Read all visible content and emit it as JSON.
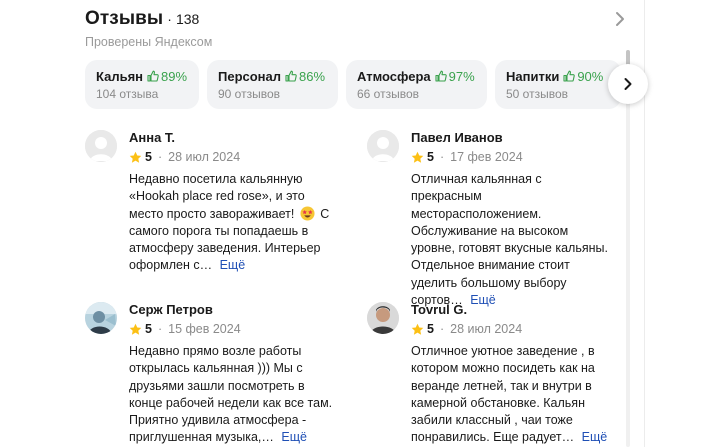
{
  "reviews_section": {
    "title": "Отзывы",
    "dot": "·",
    "count": "138",
    "subtitle": "Проверены Яндексом",
    "chips": [
      {
        "label": "Кальян",
        "percent": "89%",
        "sub": "104 отзыва"
      },
      {
        "label": "Персонал",
        "percent": "86%",
        "sub": "90 отзывов"
      },
      {
        "label": "Атмосфера",
        "percent": "97%",
        "sub": "66 отзывов"
      },
      {
        "label": "Напитки",
        "percent": "90%",
        "sub": "50 отзывов"
      }
    ]
  },
  "reviews": [
    {
      "author": "Анна Т.",
      "rating": "5",
      "date": "28 июл 2024",
      "text_before": "Недавно посетила кальянную «Hookah place red rose», и это место просто завораживает!",
      "text_after": "С самого порога ты попадаешь в атмосферу заведения. Интерьер оформлен с…",
      "more": "Ещё",
      "avatar": "default-avatar-icon"
    },
    {
      "author": "Павел Иванов",
      "rating": "5",
      "date": "17 фев 2024",
      "text": "Отличная кальянная с прекрасным месторасположением. Обслуживание на высоком уровне, готовят вкусные кальяны. Отдельное внимание стоит уделить большому выбору сортов…",
      "more": "Ещё",
      "avatar": "default-avatar-icon"
    },
    {
      "author": "Серж Петров",
      "rating": "5",
      "date": "15 фев 2024",
      "text": "Недавно прямо возле работы открылась кальянная ))) Мы с друзьями зашли посмотреть в конце рабочей недели как все там. Приятно удивила атмосфера - приглушенная музыка,…",
      "more": "Ещё",
      "avatar": "photo-avatar"
    },
    {
      "author": "Tovrul G.",
      "rating": "5",
      "date": "28 июл 2024",
      "text": "Отличное уютное заведение , в котором можно посидеть как на веранде летней, так и внутри в камерной обстановке. Кальян забили классный , чаи тоже понравились. Еще радует…",
      "more": "Ещё",
      "avatar": "photo-avatar"
    }
  ],
  "colors": {
    "accent_green": "#3aa24d",
    "link_blue": "#1f4fb5",
    "star_yellow": "#fcc015",
    "chip_bg": "#f2f3f5"
  }
}
